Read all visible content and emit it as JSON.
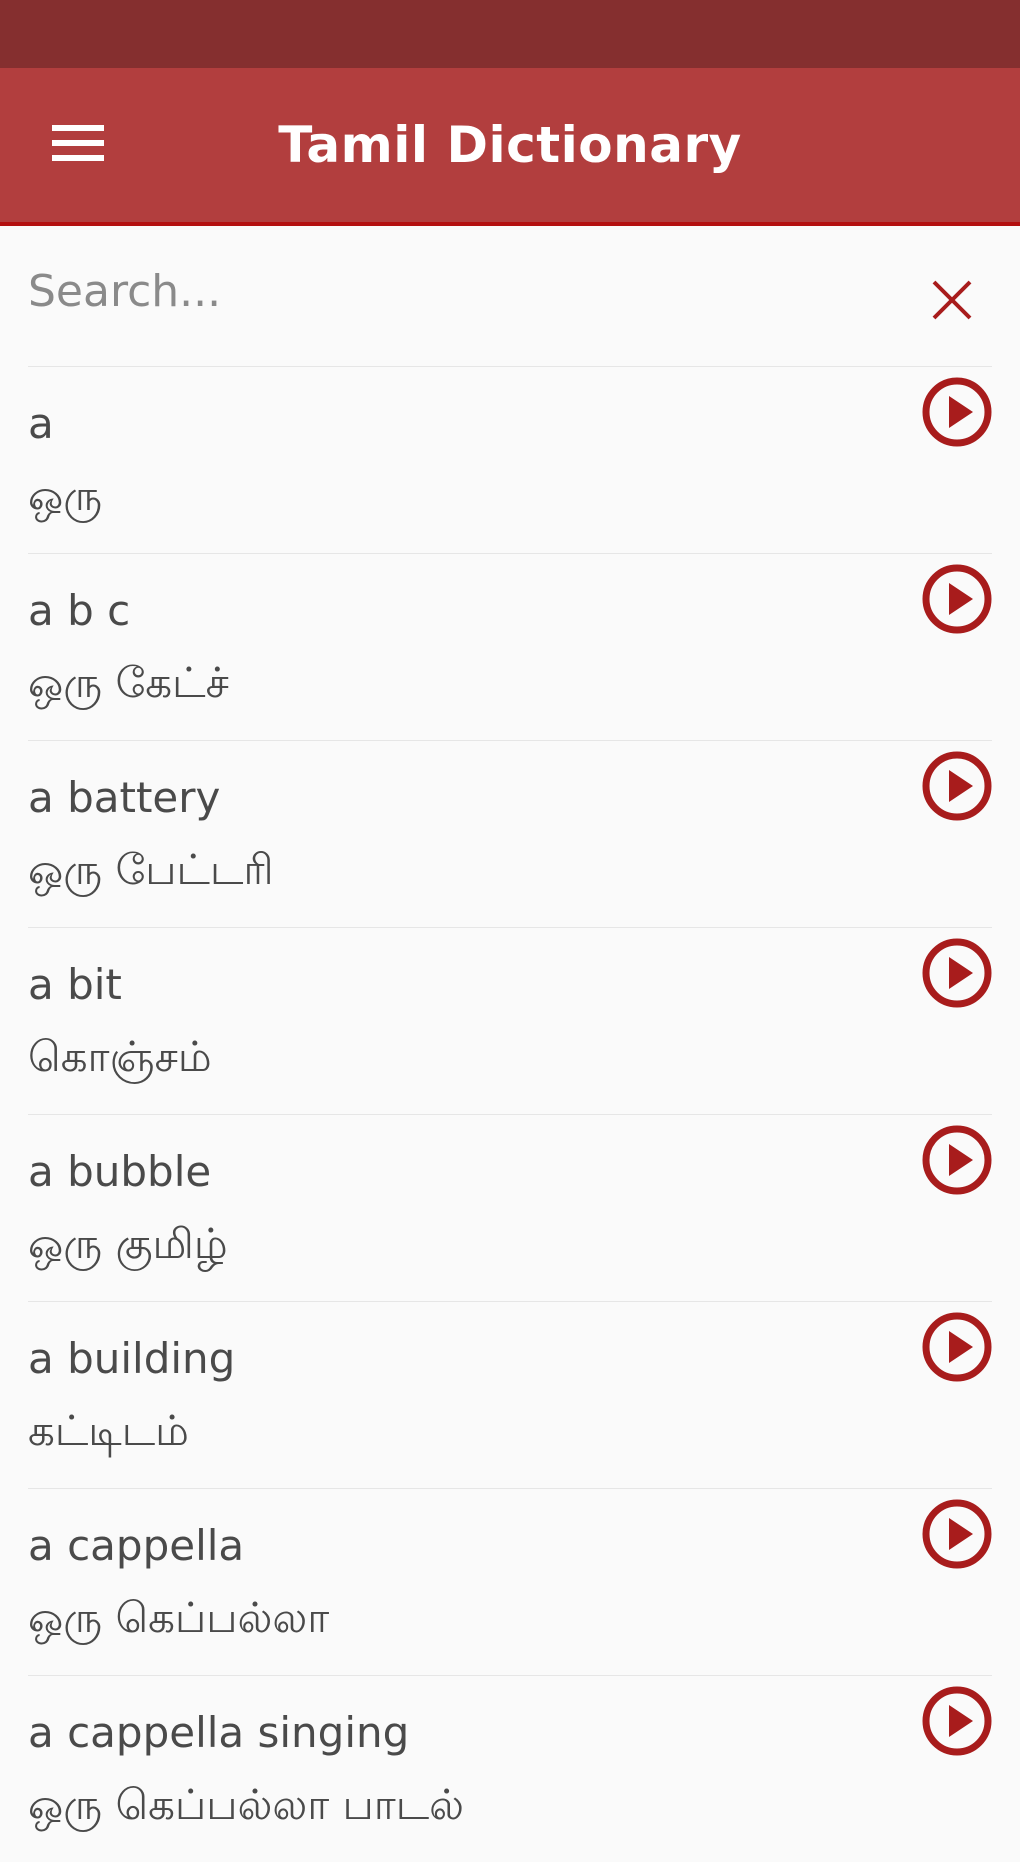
{
  "app_bar": {
    "title": "Tamil Dictionary",
    "menu_icon": "hamburger-menu-icon"
  },
  "search": {
    "placeholder": "Search...",
    "value": "",
    "clear_icon": "close-icon"
  },
  "colors": {
    "status_bar": "#852f2f",
    "app_bar": "#b23e3e",
    "accent": "#a81c1c",
    "background": "#fafafa"
  },
  "words": [
    {
      "english": "a",
      "tamil": "ஒரு"
    },
    {
      "english": "a b c",
      "tamil": "ஒரு கேட்ச்"
    },
    {
      "english": "a battery",
      "tamil": "ஒரு பேட்டரி"
    },
    {
      "english": "a bit",
      "tamil": "கொஞ்சம்"
    },
    {
      "english": "a bubble",
      "tamil": "ஒரு குமிழ்"
    },
    {
      "english": "a building",
      "tamil": "கட்டிடம்"
    },
    {
      "english": "a cappella",
      "tamil": "ஒரு கெப்பல்லா"
    },
    {
      "english": "a cappella singing",
      "tamil": "ஒரு கெப்பல்லா பாடல்"
    }
  ]
}
